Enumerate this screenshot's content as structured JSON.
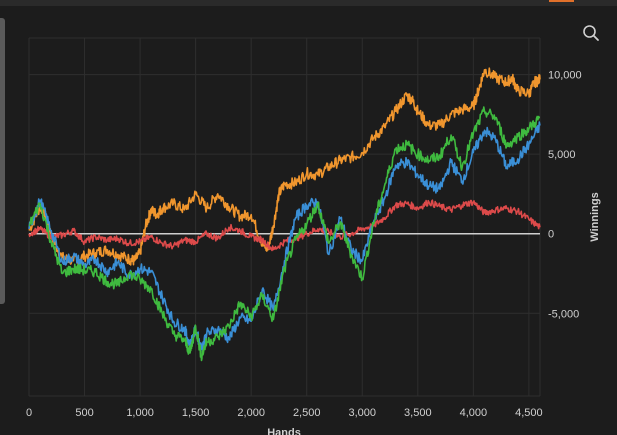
{
  "toolbar": {
    "zoom_icon": "search-icon"
  },
  "colors": {
    "background": "#1c1c1c",
    "grid": "#2e2e2e",
    "zero_line": "#cfcfcf",
    "accent": "#e0702a"
  },
  "chart_data": {
    "type": "line",
    "title": "",
    "xlabel": "Hands",
    "ylabel": "Winnings",
    "xlim": [
      0,
      4600
    ],
    "ylim": [
      -10200,
      12300
    ],
    "x_ticks": [
      0,
      500,
      1000,
      1500,
      2000,
      2500,
      3000,
      3500,
      4000,
      4500
    ],
    "x_tick_labels": [
      "0",
      "500",
      "1,000",
      "1,500",
      "2,000",
      "2,500",
      "3,000",
      "3,500",
      "4,000",
      "4,500"
    ],
    "y_ticks": [
      10000,
      5000,
      0,
      -5000
    ],
    "y_tick_labels": [
      "10,000",
      "5,000",
      "0",
      "-5,000"
    ],
    "grid": true,
    "legend": "none",
    "series": [
      {
        "color": "#f0962e",
        "x": [
          0,
          100,
          130,
          200,
          300,
          400,
          500,
          600,
          700,
          800,
          900,
          950,
          1000,
          1050,
          1100,
          1150,
          1200,
          1300,
          1400,
          1500,
          1600,
          1700,
          1800,
          1900,
          2000,
          2100,
          2150,
          2200,
          2250,
          2300,
          2400,
          2500,
          2600,
          2700,
          2800,
          2900,
          3000,
          3100,
          3200,
          3300,
          3400,
          3450,
          3500,
          3600,
          3700,
          3800,
          3900,
          4000,
          4050,
          4100,
          4200,
          4300,
          4350,
          4400,
          4500,
          4550,
          4600
        ],
        "y": [
          200,
          1700,
          1500,
          -200,
          -1500,
          -1700,
          -1400,
          -1200,
          -1000,
          -1300,
          -1600,
          -1700,
          -1200,
          500,
          1500,
          1200,
          1600,
          1900,
          1500,
          2500,
          1600,
          2500,
          1700,
          1100,
          1200,
          -600,
          -1000,
          500,
          2500,
          3100,
          3200,
          3800,
          3700,
          4200,
          4600,
          4800,
          5100,
          6000,
          6700,
          7700,
          8700,
          8400,
          7700,
          6800,
          6800,
          7500,
          7800,
          8000,
          9100,
          10300,
          9800,
          9500,
          9800,
          9000,
          8800,
          9500,
          9700
        ]
      },
      {
        "color": "#dc4a4a",
        "x": [
          0,
          100,
          200,
          300,
          400,
          500,
          600,
          700,
          800,
          900,
          1000,
          1100,
          1200,
          1300,
          1400,
          1500,
          1600,
          1700,
          1800,
          1900,
          2000,
          2100,
          2200,
          2300,
          2400,
          2500,
          2600,
          2700,
          2800,
          2900,
          3000,
          3100,
          3200,
          3300,
          3400,
          3500,
          3600,
          3700,
          3800,
          3900,
          4000,
          4100,
          4200,
          4300,
          4400,
          4500,
          4600
        ],
        "y": [
          0,
          300,
          -200,
          -100,
          200,
          -500,
          -200,
          -400,
          -300,
          -600,
          -500,
          -200,
          -600,
          -800,
          -400,
          -500,
          0,
          -300,
          400,
          200,
          -200,
          -400,
          -1000,
          -500,
          -300,
          0,
          300,
          100,
          -200,
          0,
          300,
          500,
          1000,
          1800,
          1900,
          1600,
          2000,
          1700,
          1500,
          1800,
          2000,
          1300,
          1500,
          1600,
          1400,
          900,
          400
        ]
      },
      {
        "color": "#3a8fd6",
        "x": [
          0,
          100,
          200,
          300,
          400,
          500,
          600,
          700,
          800,
          900,
          1000,
          1100,
          1200,
          1300,
          1400,
          1450,
          1500,
          1550,
          1600,
          1700,
          1800,
          1900,
          2000,
          2100,
          2200,
          2300,
          2400,
          2500,
          2600,
          2700,
          2800,
          2900,
          3000,
          3100,
          3200,
          3300,
          3400,
          3500,
          3600,
          3700,
          3800,
          3900,
          4000,
          4100,
          4200,
          4300,
          4400,
          4500,
          4600
        ],
        "y": [
          300,
          2100,
          200,
          -1800,
          -1400,
          -2000,
          -1600,
          -2400,
          -1800,
          -2600,
          -2200,
          -2400,
          -4000,
          -5500,
          -6000,
          -7000,
          -6000,
          -7200,
          -6300,
          -6000,
          -6600,
          -5300,
          -5500,
          -3500,
          -4800,
          -1700,
          1000,
          1800,
          2000,
          -1300,
          1000,
          -1000,
          -1700,
          700,
          2200,
          4300,
          4500,
          3700,
          3000,
          2800,
          4500,
          3300,
          5100,
          6500,
          5900,
          4200,
          4700,
          5600,
          6800
        ]
      },
      {
        "color": "#3fba3f",
        "x": [
          0,
          100,
          200,
          300,
          400,
          500,
          600,
          700,
          800,
          900,
          1000,
          1100,
          1200,
          1300,
          1400,
          1450,
          1500,
          1550,
          1600,
          1700,
          1800,
          1900,
          2000,
          2100,
          2200,
          2300,
          2400,
          2500,
          2600,
          2700,
          2800,
          2900,
          3000,
          3100,
          3200,
          3300,
          3400,
          3500,
          3600,
          3700,
          3800,
          3900,
          4000,
          4100,
          4200,
          4300,
          4400,
          4500,
          4600
        ],
        "y": [
          500,
          1900,
          -500,
          -2500,
          -2200,
          -2300,
          -2400,
          -3000,
          -3200,
          -2500,
          -2900,
          -3500,
          -5000,
          -6300,
          -6700,
          -7500,
          -5800,
          -7700,
          -6800,
          -6500,
          -5800,
          -4400,
          -5200,
          -3900,
          -5400,
          -2200,
          -400,
          600,
          1900,
          -600,
          700,
          -1300,
          -2800,
          600,
          3000,
          5300,
          5600,
          5000,
          4600,
          4900,
          6200,
          4200,
          6300,
          7700,
          7300,
          5500,
          6100,
          6600,
          7300
        ]
      }
    ]
  }
}
